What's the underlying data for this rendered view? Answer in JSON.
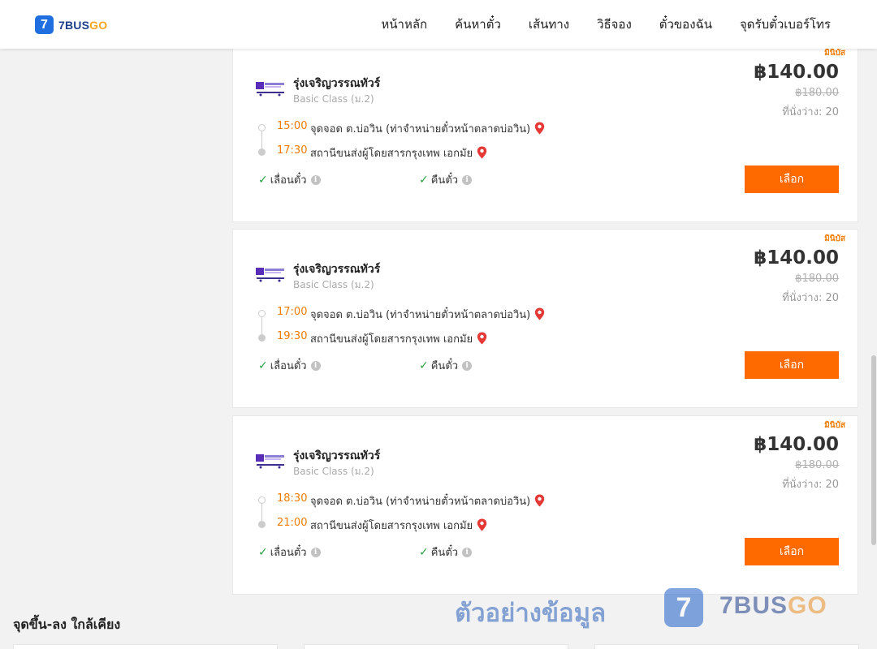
{
  "header": {
    "logo_text": "7BUS",
    "logo_text_go": "GO",
    "logo_mark": "7",
    "nav": [
      "หน้าหลัก",
      "ค้นหาตั๋ว",
      "เส้นทาง",
      "วิธีจอง",
      "ตั๋วของฉัน",
      "จุดรับตั๋วเบอร์โทร"
    ]
  },
  "trips": [
    {
      "badge": "มินิบัส",
      "operator": "รุ่งเจริญวรรณทัวร์",
      "bus_class": "Basic Class (ม.2)",
      "price": "฿140.00",
      "old_price": "฿180.00",
      "seats": "ที่นั่งว่าง: 20",
      "depart_time": "15:00",
      "depart_place": "จุดจอด ต.บ่อวิน (ท่าจำหน่ายตั๋วหน้าตลาดบ่อวิน)",
      "arrive_time": "17:30",
      "arrive_place": "สถานีขนส่งผู้โดยสารกรุงเทพ เอกมัย",
      "feature_1": "เลื่อนตั๋ว",
      "feature_2": "คืนตั๋ว",
      "select_label": "เลือก"
    },
    {
      "badge": "มินิบัส",
      "operator": "รุ่งเจริญวรรณทัวร์",
      "bus_class": "Basic Class (ม.2)",
      "price": "฿140.00",
      "old_price": "฿180.00",
      "seats": "ที่นั่งว่าง: 20",
      "depart_time": "17:00",
      "depart_place": "จุดจอด ต.บ่อวิน (ท่าจำหน่ายตั๋วหน้าตลาดบ่อวิน)",
      "arrive_time": "19:30",
      "arrive_place": "สถานีขนส่งผู้โดยสารกรุงเทพ เอกมัย",
      "feature_1": "เลื่อนตั๋ว",
      "feature_2": "คืนตั๋ว",
      "select_label": "เลือก"
    },
    {
      "badge": "มินิบัส",
      "operator": "รุ่งเจริญวรรณทัวร์",
      "bus_class": "Basic Class (ม.2)",
      "price": "฿140.00",
      "old_price": "฿180.00",
      "seats": "ที่นั่งว่าง: 20",
      "depart_time": "18:30",
      "depart_place": "จุดจอด ต.บ่อวิน (ท่าจำหน่ายตั๋วหน้าตลาดบ่อวิน)",
      "arrive_time": "21:00",
      "arrive_place": "สถานีขนส่งผู้โดยสารกรุงเทพ เอกมัย",
      "feature_1": "เลื่อนตั๋ว",
      "feature_2": "คืนตั๋ว",
      "select_label": "เลือก"
    }
  ],
  "nearby": {
    "title": "จุดขึ้น-ลง ใกล้เคียง"
  },
  "watermark": {
    "text": "ตัวอย่างข้อมูล",
    "mark": "7",
    "brand": "7BUS",
    "brand_go": "GO"
  },
  "colors": {
    "accent_orange": "#ff6a00",
    "time_orange": "#f07c00",
    "brand_blue": "#1f6fe0",
    "check_green": "#2ea043",
    "pin_red": "#e53935"
  },
  "icons": [
    "pin-icon",
    "check-icon",
    "info-icon",
    "operator-logo"
  ]
}
